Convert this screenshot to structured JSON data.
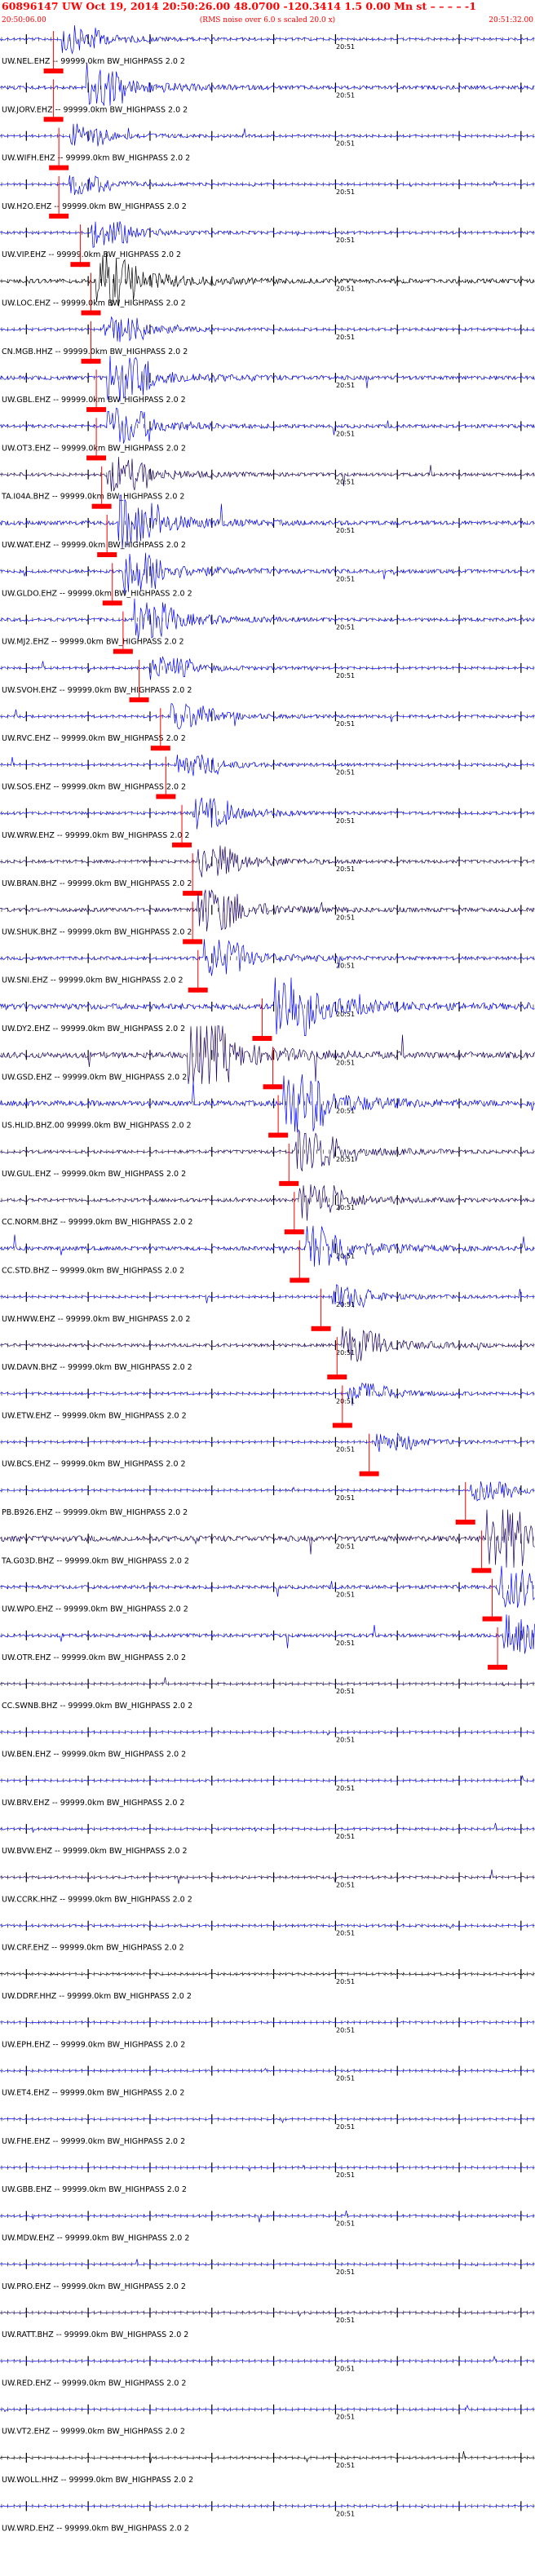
{
  "header": {
    "title": "60896147 UW Oct 19, 2014 20:50:26.00    48.0700 -120.3414  1.5 0.00 Mn st – – – –  -1",
    "start_time": "20:50:06.00",
    "subtitle": "(RMS noise over 6.0 s scaled 20.0 x)",
    "end_time": "20:51:32.00"
  },
  "colors": {
    "title": "#ff0000",
    "pick_marker": "#ff0000",
    "trace_blue": "#0000ff",
    "trace_navy": "#1a0066",
    "trace_black": "#000000",
    "label": "#000000",
    "ticks": "#000000"
  },
  "chart_data": {
    "type": "line",
    "x_range_seconds": [
      0,
      86
    ],
    "tick_label": "20:51",
    "channels": [
      {
        "label": "UW.NEL.EHZ -- 99999.0km BW_HIGHPASS  2.0  2",
        "color": "blue",
        "pick": 0.1,
        "event": 0.115,
        "amp": 0.35
      },
      {
        "label": "UW.JORV.EHZ -- 99999.0km BW_HIGHPASS  2.0  2",
        "color": "blue",
        "pick": 0.1,
        "event": 0.16,
        "amp": 0.55
      },
      {
        "label": "UW.WIFH.EHZ -- 99999.0km BW_HIGHPASS  2.0  2",
        "color": "blue",
        "pick": 0.11,
        "event": 0.13,
        "amp": 0.3
      },
      {
        "label": "UW.H2O.EHZ -- 99999.0km BW_HIGHPASS  2.0  2",
        "color": "blue",
        "pick": 0.11,
        "event": 0.13,
        "amp": 0.25
      },
      {
        "label": "UW.VIP.EHZ -- 99999.0km BW_HIGHPASS  2.0  2",
        "color": "blue",
        "pick": 0.15,
        "event": 0.17,
        "amp": 0.35
      },
      {
        "label": "UW.LOC.EHZ -- 99999.0km BW_HIGHPASS  2.0  2",
        "color": "black",
        "pick": 0.17,
        "event": 0.18,
        "amp": 0.7
      },
      {
        "label": "CN.MGB.HHZ -- 99999.0km BW_HIGHPASS  2.0  2",
        "color": "blue",
        "pick": 0.17,
        "event": 0.19,
        "amp": 0.35
      },
      {
        "label": "UW.GBL.EHZ -- 99999.0km BW_HIGHPASS  2.0  2",
        "color": "blue",
        "pick": 0.18,
        "event": 0.2,
        "amp": 0.6
      },
      {
        "label": "UW.OT3.EHZ -- 99999.0km BW_HIGHPASS  2.0  2",
        "color": "blue",
        "pick": 0.18,
        "event": 0.2,
        "amp": 0.5
      },
      {
        "label": "TA.I04A.BHZ -- 99999.0km BW_HIGHPASS  2.0  2",
        "color": "navy",
        "pick": 0.19,
        "event": 0.2,
        "amp": 0.45
      },
      {
        "label": "UW.WAT.EHZ -- 99999.0km BW_HIGHPASS  2.0  2",
        "color": "blue",
        "pick": 0.2,
        "event": 0.22,
        "amp": 0.65
      },
      {
        "label": "UW.GLDO.EHZ -- 99999.0km BW_HIGHPASS  2.0  2",
        "color": "blue",
        "pick": 0.21,
        "event": 0.23,
        "amp": 0.55
      },
      {
        "label": "UW.MJ2.EHZ -- 99999.0km BW_HIGHPASS  2.0  2",
        "color": "blue",
        "pick": 0.23,
        "event": 0.25,
        "amp": 0.5
      },
      {
        "label": "UW.SVOH.EHZ -- 99999.0km BW_HIGHPASS  2.0  2",
        "color": "blue",
        "pick": 0.26,
        "event": 0.28,
        "amp": 0.3
      },
      {
        "label": "UW.RVC.EHZ -- 99999.0km BW_HIGHPASS  2.0  2",
        "color": "blue",
        "pick": 0.3,
        "event": 0.32,
        "amp": 0.35
      },
      {
        "label": "UW.SOS.EHZ -- 99999.0km BW_HIGHPASS  2.0  2",
        "color": "blue",
        "pick": 0.31,
        "event": 0.33,
        "amp": 0.3
      },
      {
        "label": "UW.WRW.EHZ -- 99999.0km BW_HIGHPASS  2.0  2",
        "color": "blue",
        "pick": 0.34,
        "event": 0.36,
        "amp": 0.4
      },
      {
        "label": "UW.BRAN.BHZ -- 99999.0km BW_HIGHPASS  2.0  2",
        "color": "navy",
        "pick": 0.36,
        "event": 0.37,
        "amp": 0.45
      },
      {
        "label": "UW.SHUK.BHZ -- 99999.0km BW_HIGHPASS  2.0  2",
        "color": "navy",
        "pick": 0.36,
        "event": 0.37,
        "amp": 0.6
      },
      {
        "label": "UW.SNI.EHZ -- 99999.0km BW_HIGHPASS  2.0  2",
        "color": "blue",
        "pick": 0.37,
        "event": 0.38,
        "amp": 0.5
      },
      {
        "label": "UW.DY2.EHZ -- 99999.0km BW_HIGHPASS  2.0  2",
        "color": "blue",
        "pick": 0.49,
        "event": 0.51,
        "amp": 0.95
      },
      {
        "label": "UW.GSD.EHZ -- 99999.0km BW_HIGHPASS  2.0  2",
        "color": "navy",
        "pick": 0.51,
        "event": 0.35,
        "amp": 0.95
      },
      {
        "label": "US.HLID.BHZ.00 99999.0km BW_HIGHPASS  2.0  2",
        "color": "blue",
        "pick": 0.52,
        "event": 0.53,
        "amp": 0.85
      },
      {
        "label": "UW.GUL.EHZ -- 99999.0km BW_HIGHPASS  2.0  2",
        "color": "navy",
        "pick": 0.54,
        "event": 0.55,
        "amp": 0.5
      },
      {
        "label": "CC.NORM.BHZ -- 99999.0km BW_HIGHPASS  2.0  2",
        "color": "navy",
        "pick": 0.55,
        "event": 0.56,
        "amp": 0.5
      },
      {
        "label": "CC.STD.BHZ -- 99999.0km BW_HIGHPASS  2.0  2",
        "color": "blue",
        "pick": 0.56,
        "event": 0.57,
        "amp": 0.6
      },
      {
        "label": "UW.HWW.EHZ -- 99999.0km BW_HIGHPASS  2.0  2",
        "color": "blue",
        "pick": 0.6,
        "event": 0.62,
        "amp": 0.3
      },
      {
        "label": "UW.DAVN.BHZ -- 99999.0km BW_HIGHPASS  2.0  2",
        "color": "navy",
        "pick": 0.63,
        "event": 0.64,
        "amp": 0.45
      },
      {
        "label": "UW.ETW.EHZ -- 99999.0km BW_HIGHPASS  2.0  2",
        "color": "blue",
        "pick": 0.64,
        "event": 0.65,
        "amp": 0.3
      },
      {
        "label": "UW.BCS.EHZ -- 99999.0km BW_HIGHPASS  2.0  2",
        "color": "blue",
        "pick": 0.69,
        "event": 0.7,
        "amp": 0.25
      },
      {
        "label": "PB.B926.EHZ -- 99999.0km BW_HIGHPASS  2.0  2",
        "color": "blue",
        "pick": 0.87,
        "event": 0.88,
        "amp": 0.25
      },
      {
        "label": "TA.G03D.BHZ -- 99999.0km BW_HIGHPASS  2.0  2",
        "color": "navy",
        "pick": 0.9,
        "event": 0.91,
        "amp": 0.9
      },
      {
        "label": "UW.WPO.EHZ -- 99999.0km BW_HIGHPASS  2.0  2",
        "color": "blue",
        "pick": 0.92,
        "event": 0.93,
        "amp": 0.55
      },
      {
        "label": "UW.OTR.EHZ -- 99999.0km BW_HIGHPASS  2.0  2",
        "color": "blue",
        "pick": 0.93,
        "event": 0.94,
        "amp": 0.5
      },
      {
        "label": "CC.SWNB.BHZ -- 99999.0km BW_HIGHPASS  2.0  2",
        "color": "navy",
        "pick": null,
        "event": null,
        "amp": 0.25
      },
      {
        "label": "UW.BEN.EHZ -- 99999.0km BW_HIGHPASS  2.0  2",
        "color": "blue",
        "pick": null,
        "event": null,
        "amp": 0.2
      },
      {
        "label": "UW.BRV.EHZ -- 99999.0km BW_HIGHPASS  2.0  2",
        "color": "blue",
        "pick": null,
        "event": null,
        "amp": 0.2
      },
      {
        "label": "UW.BVW.EHZ -- 99999.0km BW_HIGHPASS  2.0  2",
        "color": "blue",
        "pick": null,
        "event": null,
        "amp": 0.3
      },
      {
        "label": "UW.CCRK.HHZ -- 99999.0km BW_HIGHPASS  2.0  2",
        "color": "navy",
        "pick": null,
        "event": null,
        "amp": 0.3
      },
      {
        "label": "UW.CRF.EHZ -- 99999.0km BW_HIGHPASS  2.0  2",
        "color": "blue",
        "pick": null,
        "event": null,
        "amp": 0.3
      },
      {
        "label": "UW.DDRF.HHZ -- 99999.0km BW_HIGHPASS  2.0  2",
        "color": "black",
        "pick": null,
        "event": null,
        "amp": 0.3
      },
      {
        "label": "UW.EPH.EHZ -- 99999.0km BW_HIGHPASS  2.0  2",
        "color": "blue",
        "pick": null,
        "event": null,
        "amp": 0.2
      },
      {
        "label": "UW.ET4.EHZ -- 99999.0km BW_HIGHPASS  2.0  2",
        "color": "blue",
        "pick": null,
        "event": null,
        "amp": 0.2
      },
      {
        "label": "UW.FHE.EHZ -- 99999.0km BW_HIGHPASS  2.0  2",
        "color": "blue",
        "pick": null,
        "event": null,
        "amp": 0.2
      },
      {
        "label": "UW.GBB.EHZ -- 99999.0km BW_HIGHPASS  2.0  2",
        "color": "blue",
        "pick": null,
        "event": null,
        "amp": 0.2
      },
      {
        "label": "UW.MDW.EHZ -- 99999.0km BW_HIGHPASS  2.0  2",
        "color": "blue",
        "pick": null,
        "event": null,
        "amp": 0.25
      },
      {
        "label": "UW.PRO.EHZ -- 99999.0km BW_HIGHPASS  2.0  2",
        "color": "blue",
        "pick": null,
        "event": null,
        "amp": 0.2
      },
      {
        "label": "UW.RATT.BHZ -- 99999.0km BW_HIGHPASS  2.0  2",
        "color": "navy",
        "pick": null,
        "event": null,
        "amp": 0.25
      },
      {
        "label": "UW.RED.EHZ -- 99999.0km BW_HIGHPASS  2.0  2",
        "color": "blue",
        "pick": null,
        "event": null,
        "amp": 0.2
      },
      {
        "label": "UW.VT2.EHZ -- 99999.0km BW_HIGHPASS  2.0  2",
        "color": "blue",
        "pick": null,
        "event": null,
        "amp": 0.2
      },
      {
        "label": "UW.WOLL.HHZ -- 99999.0km BW_HIGHPASS  2.0  2",
        "color": "black",
        "pick": null,
        "event": null,
        "amp": 0.25
      },
      {
        "label": "UW.WRD.EHZ -- 99999.0km BW_HIGHPASS  2.0  2",
        "color": "blue",
        "pick": null,
        "event": null,
        "amp": 0.2
      }
    ]
  }
}
